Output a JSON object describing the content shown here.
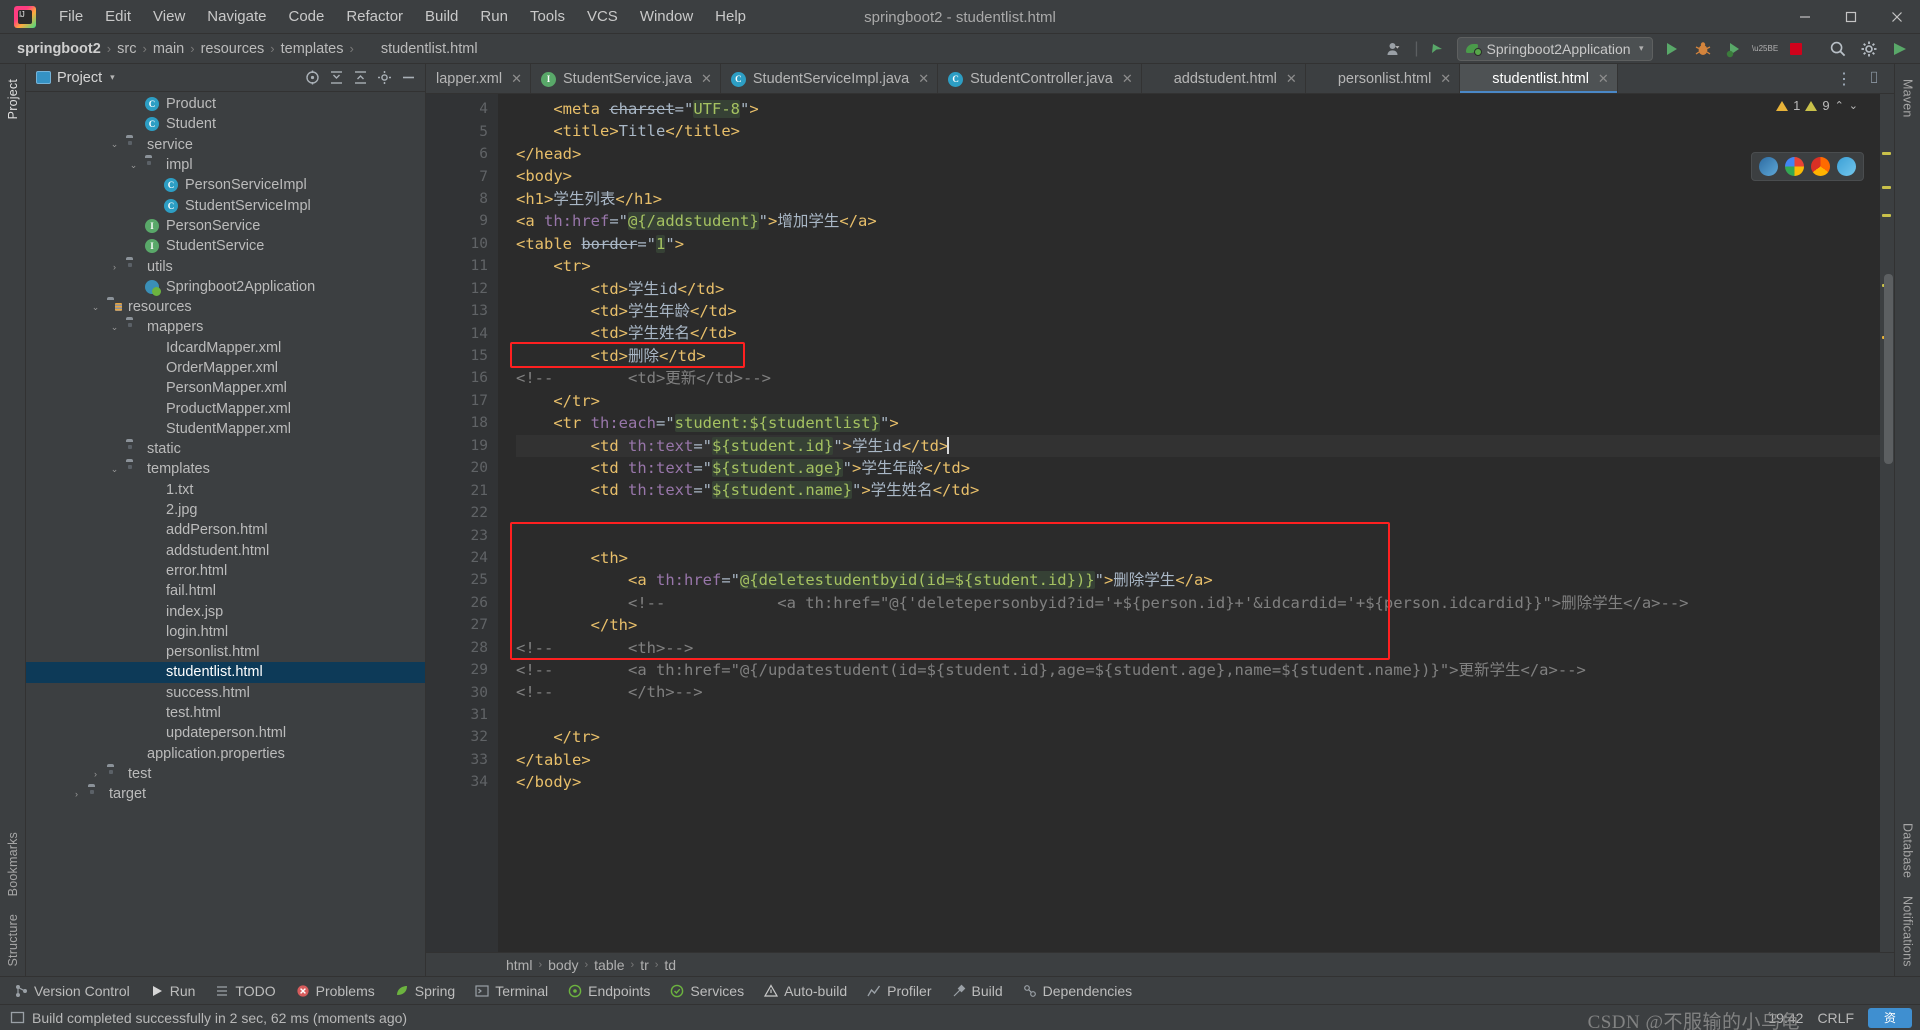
{
  "window": {
    "title": "springboot2 - studentlist.html",
    "controls": {
      "minimize": "─",
      "maximize": "☐",
      "close": "✕"
    }
  },
  "menubar": [
    "File",
    "Edit",
    "View",
    "Navigate",
    "Code",
    "Refactor",
    "Build",
    "Run",
    "Tools",
    "VCS",
    "Window",
    "Help"
  ],
  "breadcrumb": {
    "items": [
      "springboot2",
      "src",
      "main",
      "resources",
      "templates"
    ],
    "file": "studentlist.html",
    "separator": "›"
  },
  "toolbar": {
    "account_icon": "user-icon",
    "updates_icon": "arrow-icon",
    "run_config": "Springboot2Application",
    "run_label": "Run",
    "debug_label": "Debug",
    "run_coverage_label": "Run with Coverage",
    "profiler_label": "Profiler",
    "stop_label": "Stop",
    "search_label": "Search Everywhere",
    "settings_label": "Settings",
    "dropdown_caret": "▾"
  },
  "project_panel": {
    "title": "Project",
    "caret": "▾",
    "actions": [
      "select-opened-file-icon",
      "expand-all-icon",
      "collapse-all-icon",
      "settings-icon",
      "hide-icon"
    ],
    "tree": [
      {
        "label": "Product",
        "indent": 5,
        "arrow": "",
        "icon": "class",
        "badge": "C"
      },
      {
        "label": "Student",
        "indent": 5,
        "arrow": "",
        "icon": "class",
        "badge": "C"
      },
      {
        "label": "service",
        "indent": 4,
        "arrow": "⌄",
        "icon": "folder",
        "badge": ""
      },
      {
        "label": "impl",
        "indent": 5,
        "arrow": "⌄",
        "icon": "folder",
        "badge": ""
      },
      {
        "label": "PersonServiceImpl",
        "indent": 6,
        "arrow": "",
        "icon": "class",
        "badge": "C"
      },
      {
        "label": "StudentServiceImpl",
        "indent": 6,
        "arrow": "",
        "icon": "class",
        "badge": "C"
      },
      {
        "label": "PersonService",
        "indent": 5,
        "arrow": "",
        "icon": "interface",
        "badge": "I"
      },
      {
        "label": "StudentService",
        "indent": 5,
        "arrow": "",
        "icon": "interface",
        "badge": "I"
      },
      {
        "label": "utils",
        "indent": 4,
        "arrow": "›",
        "icon": "folder",
        "badge": ""
      },
      {
        "label": "Springboot2Application",
        "indent": 5,
        "arrow": "",
        "icon": "spring",
        "badge": ""
      },
      {
        "label": "resources",
        "indent": 3,
        "arrow": "⌄",
        "icon": "folder-res",
        "badge": ""
      },
      {
        "label": "mappers",
        "indent": 4,
        "arrow": "⌄",
        "icon": "folder",
        "badge": ""
      },
      {
        "label": "IdcardMapper.xml",
        "indent": 5,
        "arrow": "",
        "icon": "file",
        "badge": "xml"
      },
      {
        "label": "OrderMapper.xml",
        "indent": 5,
        "arrow": "",
        "icon": "file",
        "badge": "xml"
      },
      {
        "label": "PersonMapper.xml",
        "indent": 5,
        "arrow": "",
        "icon": "file",
        "badge": "xml"
      },
      {
        "label": "ProductMapper.xml",
        "indent": 5,
        "arrow": "",
        "icon": "file",
        "badge": "xml"
      },
      {
        "label": "StudentMapper.xml",
        "indent": 5,
        "arrow": "",
        "icon": "file",
        "badge": "xml"
      },
      {
        "label": "static",
        "indent": 4,
        "arrow": "",
        "icon": "folder",
        "badge": ""
      },
      {
        "label": "templates",
        "indent": 4,
        "arrow": "⌄",
        "icon": "folder",
        "badge": ""
      },
      {
        "label": "1.txt",
        "indent": 5,
        "arrow": "",
        "icon": "file",
        "badge": "txt"
      },
      {
        "label": "2.jpg",
        "indent": 5,
        "arrow": "",
        "icon": "file",
        "badge": "img"
      },
      {
        "label": "addPerson.html",
        "indent": 5,
        "arrow": "",
        "icon": "file",
        "badge": "h"
      },
      {
        "label": "addstudent.html",
        "indent": 5,
        "arrow": "",
        "icon": "file",
        "badge": "h"
      },
      {
        "label": "error.html",
        "indent": 5,
        "arrow": "",
        "icon": "file",
        "badge": "h"
      },
      {
        "label": "fail.html",
        "indent": 5,
        "arrow": "",
        "icon": "file",
        "badge": "h"
      },
      {
        "label": "index.jsp",
        "indent": 5,
        "arrow": "",
        "icon": "file",
        "badge": "jsp"
      },
      {
        "label": "login.html",
        "indent": 5,
        "arrow": "",
        "icon": "file",
        "badge": "h"
      },
      {
        "label": "personlist.html",
        "indent": 5,
        "arrow": "",
        "icon": "file",
        "badge": "h"
      },
      {
        "label": "studentlist.html",
        "indent": 5,
        "arrow": "",
        "icon": "file",
        "badge": "h",
        "selected": true
      },
      {
        "label": "success.html",
        "indent": 5,
        "arrow": "",
        "icon": "file",
        "badge": "h"
      },
      {
        "label": "test.html",
        "indent": 5,
        "arrow": "",
        "icon": "file",
        "badge": "h"
      },
      {
        "label": "updateperson.html",
        "indent": 5,
        "arrow": "",
        "icon": "file",
        "badge": "h"
      },
      {
        "label": "application.properties",
        "indent": 4,
        "arrow": "",
        "icon": "file",
        "badge": "txt"
      },
      {
        "label": "test",
        "indent": 3,
        "arrow": "›",
        "icon": "folder",
        "badge": ""
      },
      {
        "label": "target",
        "indent": 2,
        "arrow": "›",
        "icon": "folder",
        "badge": ""
      }
    ]
  },
  "editor_tabs": [
    {
      "label": "lapper.xml",
      "icon": "xml",
      "active": false,
      "clipped": true
    },
    {
      "label": "StudentService.java",
      "icon": "iface",
      "active": false
    },
    {
      "label": "StudentServiceImpl.java",
      "icon": "class",
      "active": false
    },
    {
      "label": "StudentController.java",
      "icon": "class",
      "active": false
    },
    {
      "label": "addstudent.html",
      "icon": "html",
      "active": false
    },
    {
      "label": "personlist.html",
      "icon": "html",
      "active": false
    },
    {
      "label": "studentlist.html",
      "icon": "html",
      "active": true
    }
  ],
  "inspections": {
    "warning_count": "1",
    "weak_warning_count": "9",
    "caret_up": "⌃",
    "caret_down": "⌄"
  },
  "browsers": [
    "ie-icon",
    "chrome-icon",
    "firefox-icon",
    "edge-icon"
  ],
  "code": {
    "first_line": 4,
    "lines": [
      {
        "n": 4,
        "text": "    <meta charset=\"UTF-8\">",
        "clip_top": true
      },
      {
        "n": 5,
        "text": "    <title>Title</title>"
      },
      {
        "n": 6,
        "text": "</head>",
        "fold": "minus"
      },
      {
        "n": 7,
        "text": "<body>",
        "fold": "minus"
      },
      {
        "n": 8,
        "text": "<h1>学生列表</h1>"
      },
      {
        "n": 9,
        "text": "<a th:href=\"@{/addstudent}\">增加学生</a>"
      },
      {
        "n": 10,
        "text": "<table border=\"1\">",
        "fold": "minus"
      },
      {
        "n": 11,
        "text": "    <tr>",
        "fold": "minus"
      },
      {
        "n": 12,
        "text": "        <td>学生id</td>"
      },
      {
        "n": 13,
        "text": "        <td>学生年龄</td>"
      },
      {
        "n": 14,
        "text": "        <td>学生姓名</td>"
      },
      {
        "n": 15,
        "text": "        <td>删除</td>",
        "boxed": true
      },
      {
        "n": 16,
        "text": "<!--        <td>更新</td>-->",
        "comment": true
      },
      {
        "n": 17,
        "text": "    </tr>",
        "fold": "plus"
      },
      {
        "n": 18,
        "text": "    <tr th:each=\"student:${studentlist}\">",
        "fold": "minus"
      },
      {
        "n": 19,
        "text": "        <td th:text=\"${student.id}\">学生id</td>",
        "current": true
      },
      {
        "n": 20,
        "text": "        <td th:text=\"${student.age}\">学生年龄</td>"
      },
      {
        "n": 21,
        "text": "        <td th:text=\"${student.name}\">学生姓名</td>"
      },
      {
        "n": 22,
        "text": ""
      },
      {
        "n": 23,
        "text": ""
      },
      {
        "n": 24,
        "text": "        <th>",
        "fold": "minus"
      },
      {
        "n": 25,
        "text": "            <a th:href=\"@{deletestudentbyid(id=${student.id})}\">删除学生</a>"
      },
      {
        "n": 26,
        "text": "            <!--            <a th:href=\"@{'deletepersonbyid?id='+${person.id}+'&idcardid='+${person.idcardid}}\">删除学生</a>-->",
        "comment": true
      },
      {
        "n": 27,
        "text": "        </th>",
        "fold": "plus"
      },
      {
        "n": 28,
        "text": "<!--        <th>-->",
        "comment": true
      },
      {
        "n": 29,
        "text": "<!--        <a th:href=\"@{/updatestudent(id=${student.id},age=${student.age},name=${student.name})}\">更新学生</a>-->",
        "comment": true
      },
      {
        "n": 30,
        "text": "<!--        </th>-->",
        "comment": true
      },
      {
        "n": 31,
        "text": ""
      },
      {
        "n": 32,
        "text": "    </tr>",
        "fold": "plus"
      },
      {
        "n": 33,
        "text": "</table>",
        "fold": "plus"
      },
      {
        "n": 34,
        "text": "</body>",
        "fold": "plus"
      }
    ]
  },
  "code_breadcrumbs": [
    "html",
    "body",
    "table",
    "tr",
    "td"
  ],
  "left_tool_strip": {
    "top": [
      "Project"
    ],
    "bottom": [
      "Bookmarks",
      "Structure"
    ]
  },
  "right_tool_strip": {
    "top": [
      "Maven"
    ],
    "bottom": [
      "Database",
      "Notifications"
    ]
  },
  "bottom_tools": [
    {
      "label": "Version Control",
      "icon": "branch-icon"
    },
    {
      "label": "Run",
      "icon": "play-icon"
    },
    {
      "label": "TODO",
      "icon": "list-icon"
    },
    {
      "label": "Problems",
      "icon": "error-icon"
    },
    {
      "label": "Spring",
      "icon": "leaf-icon"
    },
    {
      "label": "Terminal",
      "icon": "terminal-icon"
    },
    {
      "label": "Endpoints",
      "icon": "endpoints-icon"
    },
    {
      "label": "Services",
      "icon": "services-icon"
    },
    {
      "label": "Auto-build",
      "icon": "warning-icon"
    },
    {
      "label": "Profiler",
      "icon": "profiler-icon"
    },
    {
      "label": "Build",
      "icon": "hammer-icon"
    },
    {
      "label": "Dependencies",
      "icon": "dependencies-icon"
    }
  ],
  "status_bar": {
    "message": "Build completed successfully in 2 sec, 62 ms (moments ago)",
    "time": "19:42",
    "encoding": "CRLF",
    "watermark": "CSDN @不服输的小乌龟"
  },
  "colors": {
    "background": "#3c3f41",
    "editor_bg": "#2b2b2b",
    "gutter_bg": "#313335",
    "accent": "#4a88c7",
    "selection": "#0d3a58",
    "highlight_box": "#ff2020",
    "tag": "#e8bf6a",
    "string": "#a5c261",
    "comment": "#808080",
    "th_attr": "#9876aa"
  }
}
